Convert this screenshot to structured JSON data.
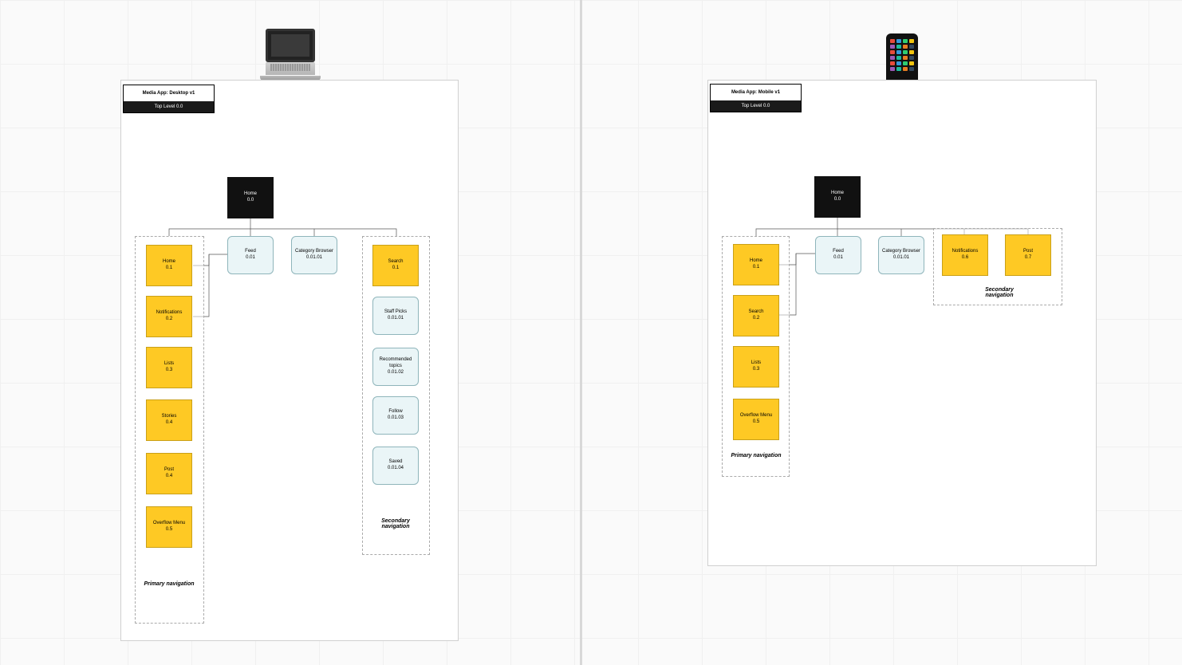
{
  "desktop": {
    "title": "Media App: Desktop v1",
    "subtitle": "Top Level 0.0",
    "home": {
      "label": "Home",
      "index": "0.0"
    },
    "primary_label": "Primary navigation",
    "secondary_label": "Secondary navigation",
    "primary": [
      {
        "label": "Home",
        "index": "0.1"
      },
      {
        "label": "Notifications",
        "index": "0.2"
      },
      {
        "label": "Lists",
        "index": "0.3"
      },
      {
        "label": "Stories",
        "index": "0.4"
      },
      {
        "label": "Post",
        "index": "0.4"
      },
      {
        "label": "Overflow Menu",
        "index": "0.5"
      }
    ],
    "feed": {
      "label": "Feed",
      "index": "0.01"
    },
    "catbrowser": {
      "label": "Category Browser",
      "index": "0.01.01"
    },
    "search": {
      "label": "Search",
      "index": "0.1"
    },
    "sec_items": [
      {
        "label": "Staff Picks",
        "index": "0.01.01"
      },
      {
        "label": "Recommended topics",
        "index": "0.01.02"
      },
      {
        "label": "Follow",
        "index": "0.01.03"
      },
      {
        "label": "Saved",
        "index": "0.01.04"
      }
    ]
  },
  "mobile": {
    "title": "Media App: Mobile v1",
    "subtitle": "Top Level 0.0",
    "home": {
      "label": "Home",
      "index": "0.0"
    },
    "primary_label": "Primary navigation",
    "secondary_label": "Secondary navigation",
    "primary": [
      {
        "label": "Home",
        "index": "0.1"
      },
      {
        "label": "Search",
        "index": "0.2"
      },
      {
        "label": "Lists",
        "index": "0.3"
      },
      {
        "label": "Overflow Menu",
        "index": "0.5"
      }
    ],
    "feed": {
      "label": "Feed",
      "index": "0.01"
    },
    "catbrowser": {
      "label": "Category Browser",
      "index": "0.01.01"
    },
    "secondary": [
      {
        "label": "Notifications",
        "index": "0.6"
      },
      {
        "label": "Post",
        "index": "0.7"
      }
    ]
  }
}
